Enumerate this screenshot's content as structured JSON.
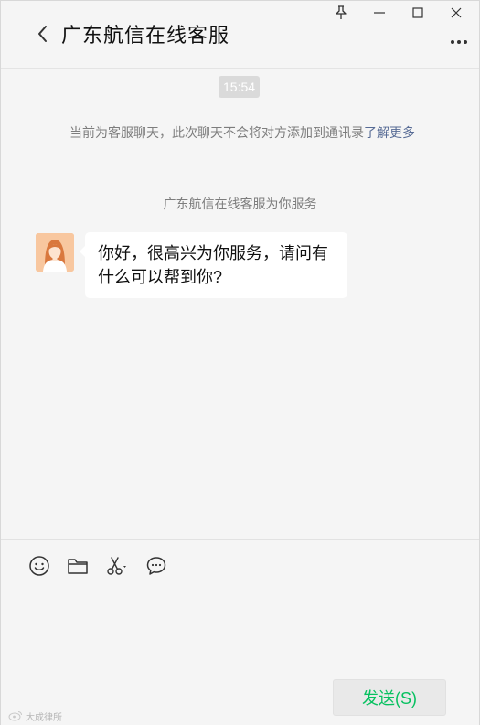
{
  "window": {
    "title": "广东航信在线客服"
  },
  "chat": {
    "time": "15:54",
    "notice": "当前为客服聊天，此次聊天不会将对方添加到通讯录",
    "notice_link": "了解更多",
    "service_note": "广东航信在线客服为你服务",
    "messages": [
      {
        "sender": "agent",
        "text": "你好，很高兴为你服务，请问有什么可以帮到你?"
      }
    ]
  },
  "input": {
    "send_label": "发送(S)"
  },
  "watermark": {
    "text": "大成律所"
  },
  "icons": {
    "back": "chevron-left-icon",
    "pin": "pin-icon",
    "minimize": "minimize-icon",
    "maximize": "maximize-icon",
    "close": "close-icon",
    "more": "more-icon",
    "emoji": "emoji-icon",
    "folder": "folder-icon",
    "screenshot": "scissors-icon",
    "chat": "chat-bubble-icon"
  },
  "colors": {
    "background": "#f5f5f5",
    "bubble": "#ffffff",
    "send_text": "#07c160",
    "link": "#576b95"
  }
}
